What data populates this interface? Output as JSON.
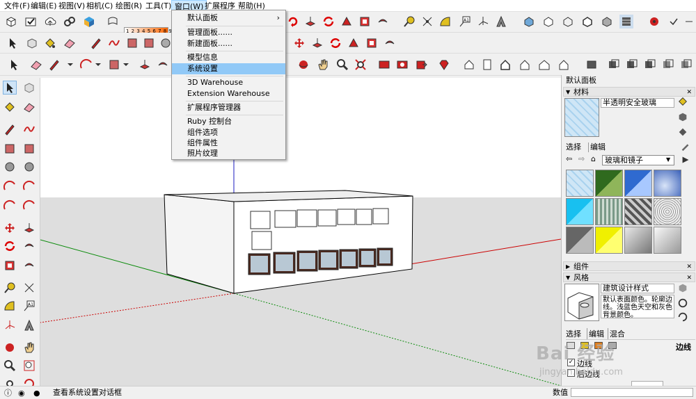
{
  "menubar": {
    "items": [
      "文件(F)",
      "编辑(E)",
      "视图(V)",
      "相机(C)",
      "绘图(R)",
      "工具(T)",
      "窗口(W)",
      "扩展程序",
      "帮助(H)"
    ]
  },
  "dropdown": {
    "items": [
      "默认面板",
      "管理面板......",
      "新建面板......",
      "模型信息",
      "系统设置",
      "3D Warehouse",
      "Extension Warehouse",
      "扩展程序管理器",
      "Ruby 控制台",
      "组件选项",
      "组件属性",
      "照片纹理"
    ],
    "submenu_arrow": "›"
  },
  "toolbar1": {
    "scale_numbers": "1 2 3 4 5 6 7 8 9 10"
  },
  "tray": {
    "title": "默认面板",
    "materials_section": "材料",
    "material_name": "半透明安全玻璃",
    "tab_select": "选择",
    "tab_edit": "编辑",
    "library_select": "玻璃和镜子",
    "components_section": "组件",
    "styles_section": "风格",
    "style_name": "建筑设计样式",
    "style_desc": "默认表面颜色。轮廓边线。浅蓝色天空和灰色背景颜色。",
    "style_tab_select": "选择",
    "style_tab_edit": "编辑",
    "style_tab_mix": "混合",
    "edges_label": "边线",
    "edge_checkbox": "边线",
    "back_edges": "后边线"
  },
  "watermark": {
    "text": "Bai 经验",
    "url": "jingyan.baidu.com"
  },
  "statusbar": {
    "hint": "查看系统设置对话框",
    "value_label": "数值"
  },
  "colors": {
    "accent_blue": "#3a76c4",
    "menu_highlight": "#91c9f7",
    "axis_red": "#c00000",
    "axis_green": "#008000",
    "axis_blue": "#0000c0",
    "sky": "#ffffff",
    "ground": "#dcdcdc"
  }
}
